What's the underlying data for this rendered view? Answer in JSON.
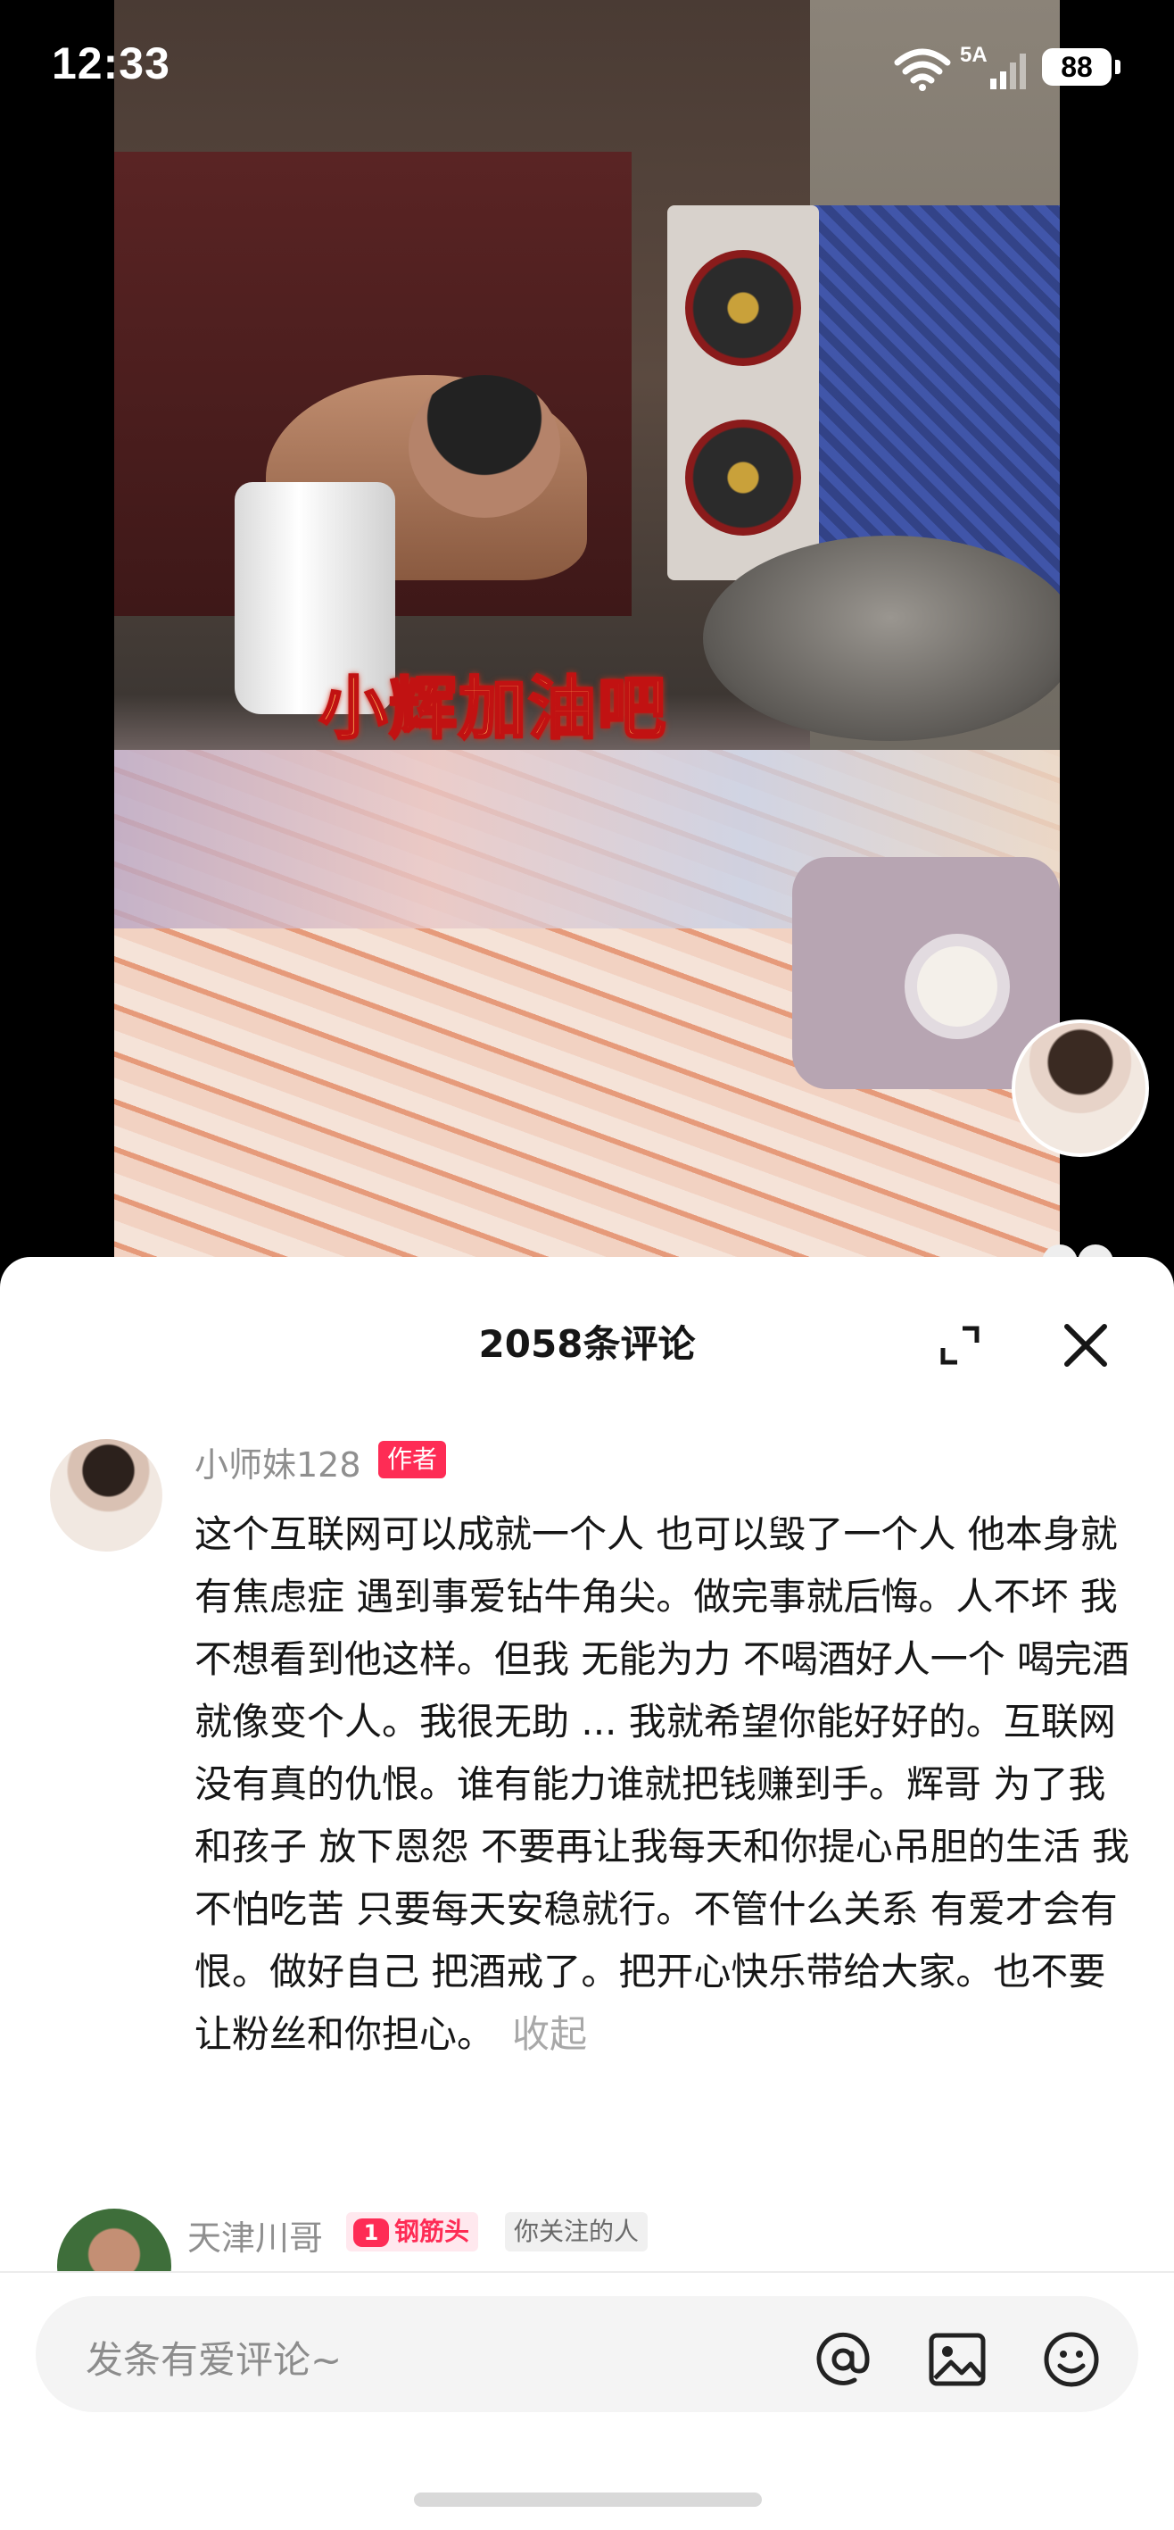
{
  "status_bar": {
    "time": "12:33",
    "network": "5A",
    "battery": "88"
  },
  "video": {
    "caption": "小辉加油吧"
  },
  "comments_panel": {
    "title": "2058条评论",
    "comments": [
      {
        "username": "小师妹128",
        "badge": "作者",
        "text": "这个互联网可以成就一个人 也可以毁了一个人 他本身就有焦虑症 遇到事爱钻牛角尖。做完事就后悔。人不坏 我不想看到他这样。但我 无能为力 不喝酒好人一个 喝完酒就像变个人。我很无助 ... 我就希望你能好好的。互联网没有真的仇恨。谁有能力谁就把钱赚到手。辉哥 为了我和孩子 放下恩怨 不要再让我每天和你提心吊胆的生活 我不怕吃苦 只要每天安稳就行。不管什么关系 有爱才会有恨。做好自己 把酒戒了。把开心快乐带给大家。也不要让粉丝和你担心。",
        "collapse_label": "收起"
      },
      {
        "username": "天津川哥",
        "fan_level": "1",
        "fan_badge": "钢筋头",
        "follow_badge": "你关注的人"
      }
    ]
  },
  "input": {
    "placeholder": "发条有爱评论~"
  },
  "colors": {
    "accent": "#fe2c55",
    "caption_fill": "#ffb35a",
    "caption_stroke": "#c11212"
  },
  "icons": [
    "wifi-icon",
    "signal-icon",
    "battery-icon",
    "expand-icon",
    "close-icon",
    "at-icon",
    "image-icon",
    "emoji-icon"
  ]
}
